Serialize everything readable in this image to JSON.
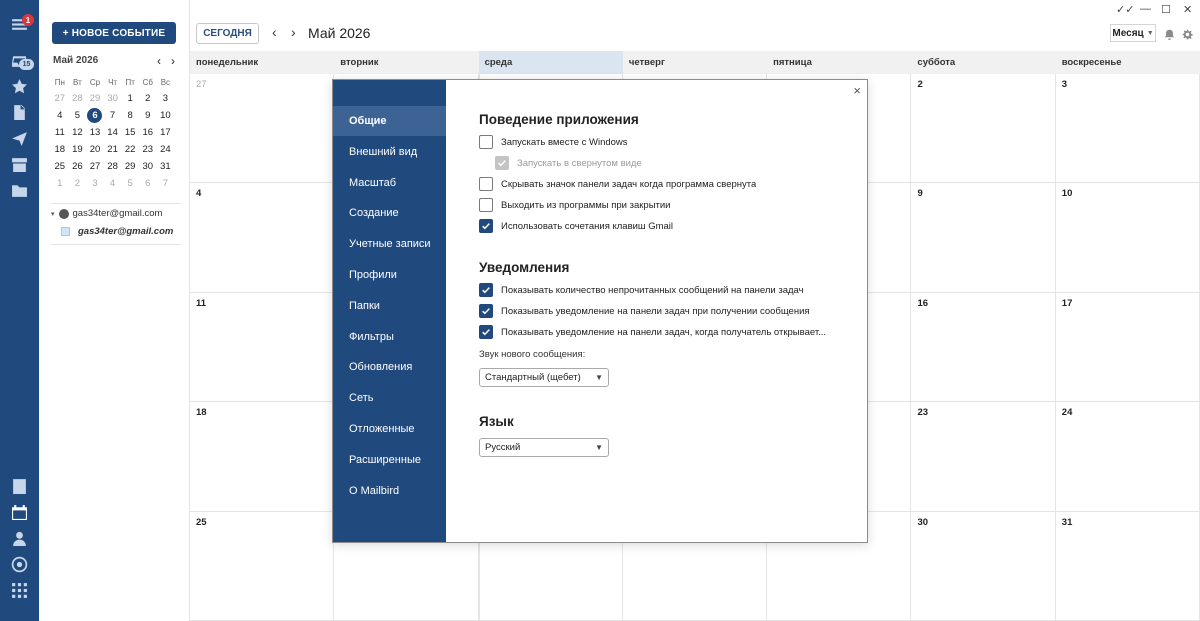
{
  "rail": {
    "menu_badge": "1",
    "inbox_count": "15",
    "icons": [
      "menu-icon",
      "inbox-icon",
      "star-icon",
      "document-icon",
      "send-icon",
      "archive-icon",
      "folder-icon",
      "notes-icon",
      "calendar-icon",
      "contacts-icon",
      "apps-ai-icon",
      "apps-grid-icon"
    ]
  },
  "sidebar": {
    "new_event_label": "+ НОВОЕ СОБЫТИЕ",
    "mini_month": "Май 2026",
    "weekdays": [
      "Пн",
      "Вт",
      "Ср",
      "Чт",
      "Пт",
      "Сб",
      "Вс"
    ],
    "days": [
      [
        "27",
        "28",
        "29",
        "30",
        "1",
        "2",
        "3"
      ],
      [
        "4",
        "5",
        "6",
        "7",
        "8",
        "9",
        "10"
      ],
      [
        "11",
        "12",
        "13",
        "14",
        "15",
        "16",
        "17"
      ],
      [
        "18",
        "19",
        "20",
        "21",
        "22",
        "23",
        "24"
      ],
      [
        "25",
        "26",
        "27",
        "28",
        "29",
        "30",
        "31"
      ],
      [
        "1",
        "2",
        "3",
        "4",
        "5",
        "6",
        "7"
      ]
    ],
    "today": "6",
    "account_email": "gas34ter@gmail.com",
    "calendar_name": "gas34ter@gmail.com"
  },
  "toolbar": {
    "today_label": "СЕГОДНЯ",
    "prev": "‹",
    "next": "›",
    "month_title": "Май 2026",
    "view_label": "Месяц"
  },
  "calendar": {
    "weekday_headers": [
      "понедельник",
      "вторник",
      "среда",
      "четверг",
      "пятница",
      "суббота",
      "воскресенье"
    ],
    "current_weekday_index": 2,
    "visible_cells": [
      [
        "27",
        "",
        "",
        "",
        "",
        "2",
        "3"
      ],
      [
        "4",
        "",
        "",
        "",
        "",
        "9",
        "10"
      ],
      [
        "11",
        "",
        "",
        "",
        "",
        "16",
        "17"
      ],
      [
        "18",
        "",
        "",
        "",
        "",
        "23",
        "24"
      ],
      [
        "25",
        "",
        "",
        "",
        "",
        "30",
        "31"
      ]
    ]
  },
  "settings": {
    "nav": [
      "Общие",
      "Внешний вид",
      "Масштаб",
      "Создание",
      "Учетные записи",
      "Профили",
      "Папки",
      "Фильтры",
      "Обновления",
      "Сеть",
      "Отложенные",
      "Расширенные",
      "О Mailbird"
    ],
    "active_nav": "Общие",
    "behavior_title": "Поведение приложения",
    "behavior_options": [
      {
        "label": "Запускать вместе с Windows",
        "checked": false
      },
      {
        "label": "Запускать в свернутом виде",
        "checked": true,
        "disabled": true
      },
      {
        "label": "Скрывать значок панели задач когда программа свернута",
        "checked": false
      },
      {
        "label": "Выходить из программы при закрытии",
        "checked": false
      },
      {
        "label": "Использовать сочетания клавиш Gmail",
        "checked": true
      }
    ],
    "notifications_title": "Уведомления",
    "notification_options": [
      {
        "label": "Показывать количество непрочитанных сообщений на панели задач",
        "checked": true
      },
      {
        "label": "Показывать уведомление на панели задач при получении сообщения",
        "checked": true
      },
      {
        "label": "Показывать уведомление на панели задач, когда получатель открывает...",
        "checked": true
      }
    ],
    "sound_label": "Звук нового сообщения:",
    "sound_value": "Стандартный (щебет)",
    "language_title": "Язык",
    "language_value": "Русский",
    "close": "×"
  }
}
